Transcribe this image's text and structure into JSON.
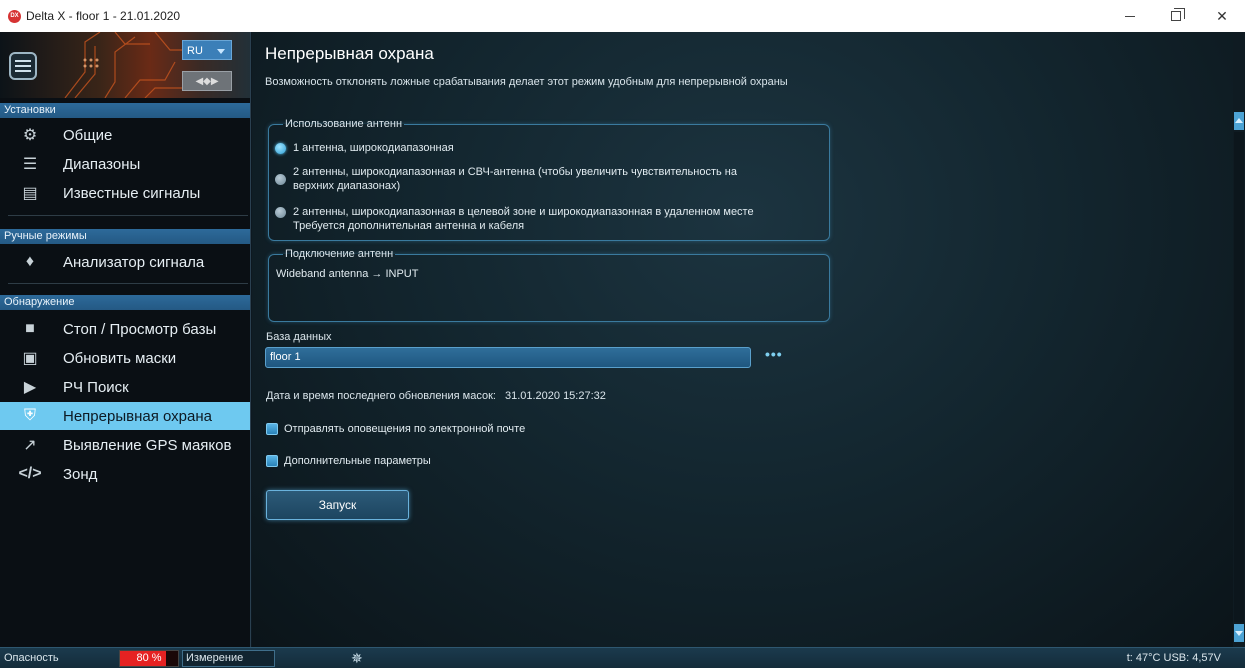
{
  "window": {
    "app_icon": "DX",
    "title": "Delta X - floor 1 - 21.01.2020"
  },
  "sidebar": {
    "language": "RU",
    "sections": [
      {
        "header": "Установки",
        "items": [
          {
            "label": "Общие",
            "icon": "gear-icon"
          },
          {
            "label": "Диапазоны",
            "icon": "list-icon"
          },
          {
            "label": "Известные сигналы",
            "icon": "clipboard-icon"
          }
        ]
      },
      {
        "header": "Ручные режимы",
        "items": [
          {
            "label": "Анализатор сигнала",
            "icon": "diamond-icon"
          }
        ]
      },
      {
        "header": "Обнаружение",
        "items": [
          {
            "label": "Стоп / Просмотр базы",
            "icon": "stop-icon"
          },
          {
            "label": "Обновить маски",
            "icon": "image-icon"
          },
          {
            "label": "РЧ Поиск",
            "icon": "play-icon"
          },
          {
            "label": "Непрерывная охрана",
            "icon": "shield-icon",
            "active": true
          },
          {
            "label": "Выявление GPS маяков",
            "icon": "trend-icon"
          },
          {
            "label": "Зонд",
            "icon": "code-icon"
          }
        ]
      }
    ]
  },
  "main": {
    "title": "Непрерывная охрана",
    "subtitle": "Возможность отклонять ложные срабатывания делает этот режим удобным для непрерывной охраны",
    "antenna_usage": {
      "legend": "Использование антенн",
      "options": [
        {
          "line1": "1 антенна, широкодиапазонная",
          "line2": "",
          "checked": true
        },
        {
          "line1": "2 антенны, широкодиапазонная и СВЧ-антенна (чтобы увеличить чувствительность на",
          "line2": "верхних диапазонах)",
          "checked": false
        },
        {
          "line1": "2 антенны, широкодиапазонная в целевой зоне и широкодиапазонная в удаленном месте",
          "line2": "Требуется дополнительная антенна и кабеля",
          "checked": false
        }
      ]
    },
    "antenna_connection": {
      "legend": "Подключение антенн",
      "text": "Wideband antenna → INPUT"
    },
    "database": {
      "label": "База данных",
      "value": "floor 1",
      "more": "•••"
    },
    "last_update": {
      "label": "Дата и время последнего обновления масок:",
      "value": "31.01.2020 15:27:32"
    },
    "email_notify": "Отправлять оповещения по электронной почте",
    "extra_params": "Дополнительные параметры",
    "start_button": "Запуск"
  },
  "statusbar": {
    "danger_label": "Опасность",
    "danger_value": "80 %",
    "danger_fraction": 0.8,
    "measure_label": "Измерение",
    "spinner": "✵",
    "temp_usb": "t: 47°C  USB: 4,57V"
  },
  "colors": {
    "accent": "#6ec9f0",
    "section_header": "#2d6a9a",
    "danger": "#e52222"
  }
}
